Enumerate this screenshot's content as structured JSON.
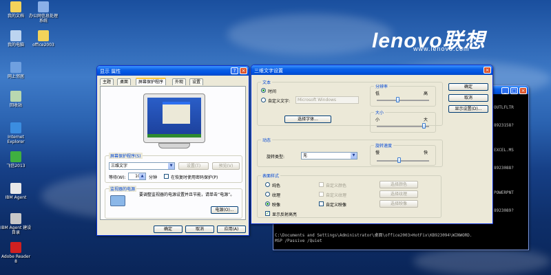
{
  "desktop": {
    "icons": [
      {
        "label": "我的文档",
        "color": "#f3d35a"
      },
      {
        "label": "办公网信息处理系统",
        "color": "#8ab0e8"
      },
      {
        "label": "我的电脑",
        "color": "#bcd4f0"
      },
      {
        "label": "office2003",
        "color": "#f3d35a"
      },
      {
        "label": "网上邻居",
        "color": "#6fa0e0"
      },
      {
        "label": "回收站",
        "color": "#b8d8b0"
      },
      {
        "label": "Internet Explorer",
        "color": "#3b8de0"
      },
      {
        "label": "飞信2013",
        "color": "#3fb040"
      },
      {
        "label": "IBM Agent",
        "color": "#e8e8e8"
      },
      {
        "label": "IBM Agent 建设目录",
        "color": "#c8c8c8"
      },
      {
        "label": "Adobe Reader 8",
        "color": "#d02020"
      }
    ],
    "brand": "lenovo联想",
    "brand_url": "www.lenovo.com"
  },
  "display_props": {
    "title": "显示 属性",
    "help": "?",
    "close": "×",
    "tabs": [
      "主题",
      "桌面",
      "屏幕保护程序",
      "外观",
      "设置"
    ],
    "screensaver_group": "屏幕保护程序(S)",
    "screensaver_value": "三维文字",
    "settings_btn": "设置(T)",
    "preview_btn": "预览(V)",
    "wait_label": "等待(W):",
    "wait_value": "10",
    "wait_unit": "分钟",
    "resume_label": "在恢复时使用密码保护(P)",
    "power_group": "监视器的电源",
    "power_text": "要调整监视器的电源设置并且节能，请单击“电源”。",
    "power_btn": "电源(O)...",
    "ok": "确定",
    "cancel": "取消",
    "apply": "应用(A)"
  },
  "text3d": {
    "title": "三维文字设置",
    "close": "×",
    "text_group": "文本",
    "time_label": "时间",
    "custom_label": "自定义文字:",
    "custom_placeholder": "Microsoft Windows",
    "font_btn": "选择字体...",
    "resolution_group": "分辨率",
    "res_low": "低",
    "res_high": "高",
    "size_group": "大小",
    "size_small": "小",
    "size_large": "大",
    "motion_group": "动态",
    "rotation_label": "旋转类型:",
    "rotation_value": "无",
    "speed_group": "旋转速度",
    "speed_slow": "慢",
    "speed_fast": "快",
    "surface_group": "表面样式",
    "solid": "纯色",
    "texture": "纹理",
    "reflection": "映像",
    "custom_color": "自定义颜色",
    "custom_texture": "自定义纹理",
    "custom_reflection": "自定义映像",
    "choose_color": "选择颜色",
    "choose_texture": "选择纹理",
    "choose_reflection": "选择映像",
    "specular": "显示反射高亮",
    "ok": "确定",
    "cancel": "取消",
    "display_settings": "显示设置(D)..."
  },
  "console": {
    "lines_right": [
      "OUTLFLTR",
      "8923158?",
      "EXCEL.MS",
      "8923088?",
      "POWERPNT",
      "8923089?"
    ],
    "cmd1": "C:\\Documents and Settings\\Administrator\\桌面\\office2003>HotFix\\KB923094\\WINWORD.",
    "cmd2": "MSP /Passive /Quiet"
  }
}
